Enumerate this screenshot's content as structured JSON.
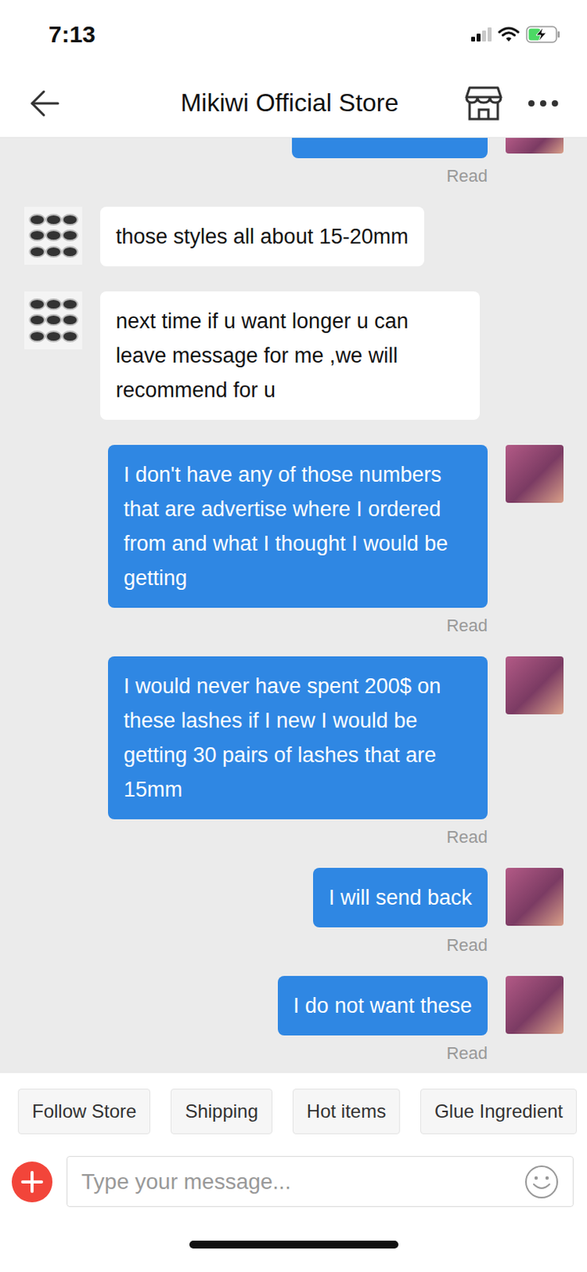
{
  "status_bar": {
    "time": "7:13",
    "signal_level": 0.5,
    "battery_level": 0.45,
    "charging": true
  },
  "nav": {
    "title": "Mikiwi Official Store"
  },
  "messages": [
    {
      "kind": "partial",
      "sender": "user",
      "text": "",
      "status": "Read"
    },
    {
      "kind": "full",
      "sender": "store",
      "text": "those styles all about 15-20mm",
      "status": ""
    },
    {
      "kind": "full",
      "sender": "store",
      "text": "next time if u want longer u can leave message for me ,we will recommend for u",
      "status": ""
    },
    {
      "kind": "full",
      "sender": "user",
      "text": "I don't have any of those numbers that are advertise where I ordered from and what I thought I would be getting",
      "status": "Read"
    },
    {
      "kind": "full",
      "sender": "user",
      "text": "I would never have spent 200$ on these lashes if I new I would be getting 30 pairs of lashes that are 15mm",
      "status": "Read"
    },
    {
      "kind": "full",
      "sender": "user",
      "text": "I will send back",
      "status": "Read"
    },
    {
      "kind": "full",
      "sender": "user",
      "text": "I do not want these",
      "status": "Read"
    }
  ],
  "chips": [
    "Follow Store",
    "Shipping",
    "Hot items",
    "Glue Ingredient"
  ],
  "input": {
    "placeholder": "Type your message..."
  }
}
